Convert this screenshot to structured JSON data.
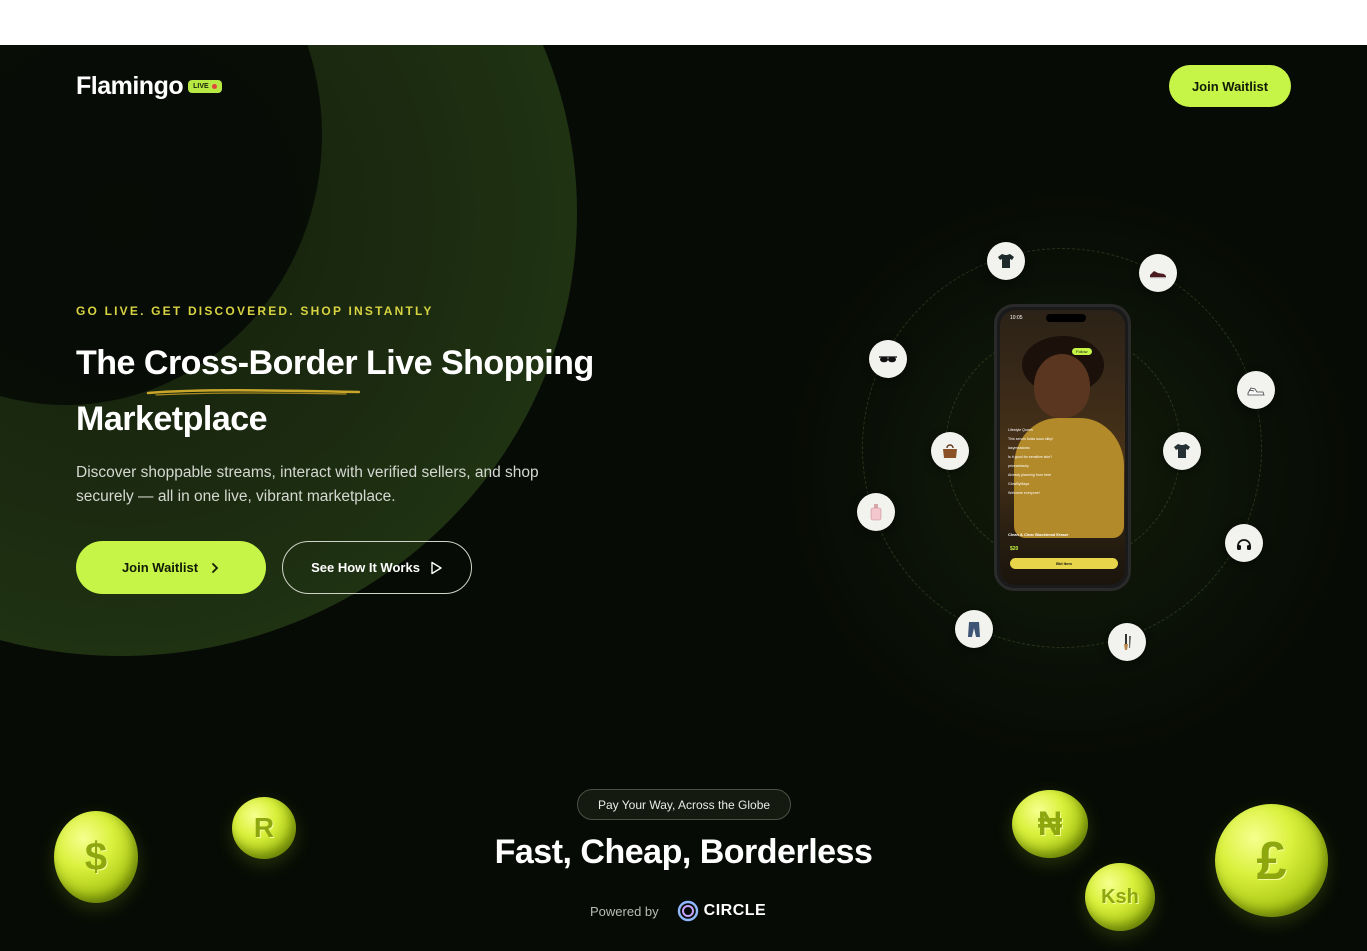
{
  "nav": {
    "logo_text": "Flamingo",
    "logo_badge": "LIVE",
    "cta_label": "Join Waitlist"
  },
  "hero": {
    "eyebrow": "GO LIVE. GET DISCOVERED. SHOP INSTANTLY",
    "headline_line1": "The Cross-Border Live Shopping",
    "headline_line2": "Marketplace",
    "subtext": "Discover shoppable streams, interact with verified sellers, and shop securely — all in one live, vibrant marketplace.",
    "primary_button": "Join Waitlist",
    "secondary_button": "See How It Works"
  },
  "phone": {
    "time": "10:05",
    "follow_label": "Follow",
    "chat": [
      "Lifestyle Queen",
      "This serum looks sooo silky!",
      "lasymeadows",
      "Is it good for sensitive skin?",
      "priceadrastry",
      "Already planning from here",
      "GlowByMaya",
      "Welcome everyone!"
    ],
    "winning": "Sassy Girl is winning!",
    "product_name": "Clean & Clear Blackhead Eraser",
    "product_price": "$20",
    "bid_label": "Bid Item"
  },
  "orbit_icons": [
    "tshirt-icon",
    "sneaker-icon",
    "sunglasses-icon",
    "shoes-icon",
    "handbag-icon",
    "tshirt-icon",
    "perfume-icon",
    "headphones-icon",
    "jeans-icon",
    "brush-icon"
  ],
  "bottom": {
    "pill": "Pay Your Way, Across the Globe",
    "title": "Fast, Cheap, Borderless",
    "powered_by": "Powered by",
    "partner": "CIRCLE"
  },
  "coins": [
    "$",
    "R",
    "₦",
    "£",
    "Ksh"
  ],
  "colors": {
    "accent": "#c6f547",
    "eyebrow": "#d8d342",
    "background": "#070b05"
  }
}
